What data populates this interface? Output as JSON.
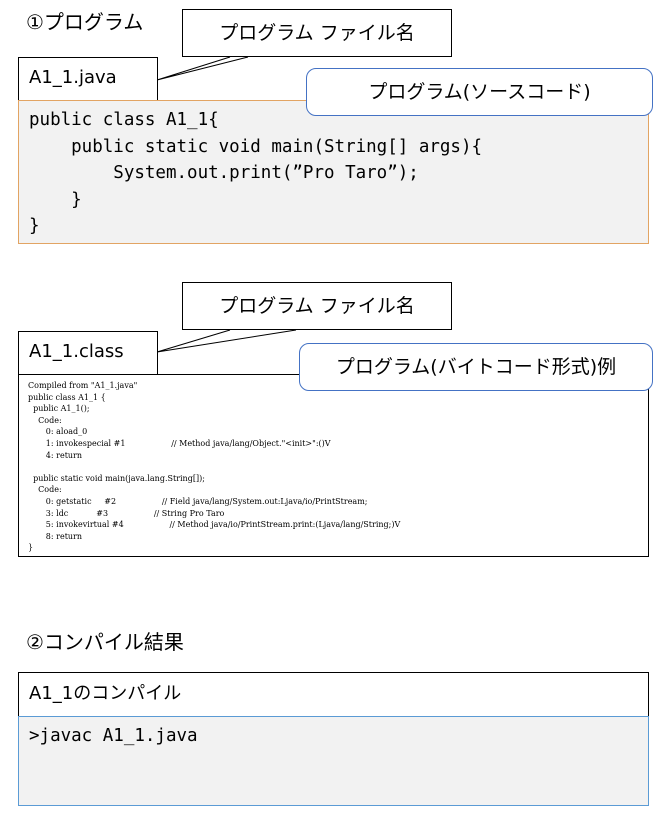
{
  "section1": {
    "heading": "①プログラム",
    "filename_callout": "プログラム ファイル名",
    "tab_label": "A1_1.java",
    "code_callout": "プログラム(ソースコード)",
    "code": "public class A1_1{\n    public static void main(String[] args){\n        System.out.print(”Pro Taro”);\n    }\n}"
  },
  "section2": {
    "filename_callout": "プログラム ファイル名",
    "tab_label": "A1_1.class",
    "code_callout": "プログラム(バイトコード形式)例",
    "code": "Compiled from \"A1_1.java\"\npublic class A1_1 {\n  public A1_1();\n    Code:\n       0: aload_0\n       1: invokespecial #1                  // Method java/lang/Object.\"<init>\":()V\n       4: return\n\n  public static void main(java.lang.String[]);\n    Code:\n       0: getstatic     #2                  // Field java/lang/System.out:Ljava/io/PrintStream;\n       3: ldc           #3                  // String Pro Taro\n       5: invokevirtual #4                  // Method java/io/PrintStream.print:(Ljava/lang/String;)V\n       8: return\n}"
  },
  "section3": {
    "heading": "②コンパイル結果",
    "tab_label": "A1_1のコンパイル",
    "command": ">javac A1_1.java"
  }
}
